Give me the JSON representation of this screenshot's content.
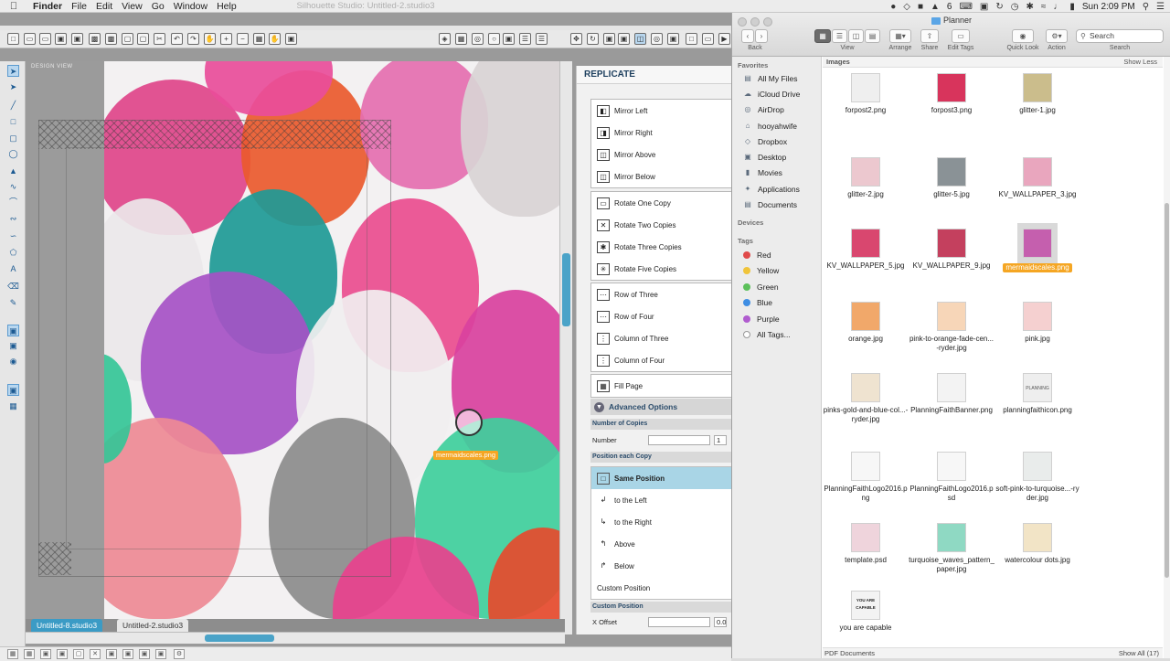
{
  "menubar": {
    "app": "Finder",
    "menus": [
      "File",
      "Edit",
      "View",
      "Go",
      "Window",
      "Help"
    ],
    "window_title": "Silhouette Studio: Untitled-2.studio3",
    "status": {
      "badge": "6",
      "clock": "Sun 2:09 PM"
    }
  },
  "studio": {
    "design_view_label": "DESIGN VIEW",
    "drag_label": "mermaidscales.png",
    "doc_tabs": [
      "Untitled-8.studio3",
      "Untitled-2.studio3"
    ],
    "colors": {
      "accent": "#3b9bc5",
      "drag": "#f5a623"
    }
  },
  "replicate": {
    "title": "REPLICATE",
    "mirror": [
      "Mirror Left",
      "Mirror Right",
      "Mirror Above",
      "Mirror Below"
    ],
    "rotate": [
      "Rotate One Copy",
      "Rotate Two Copies",
      "Rotate Three Copies",
      "Rotate Five Copies"
    ],
    "rows": [
      "Row of Three",
      "Row of Four",
      "Column of Three",
      "Column of Four"
    ],
    "fill": "Fill Page",
    "advanced": "Advanced Options",
    "number_of_copies_head": "Number of Copies",
    "number_label": "Number",
    "number_value": "1",
    "position_head": "Position each Copy",
    "positions": [
      "Same Position",
      "to the Left",
      "to the Right",
      "Above",
      "Below"
    ],
    "custom_position": "Custom Position",
    "custom_head": "Custom Position",
    "x_offset_label": "X Offset",
    "x_offset_value": "0.0"
  },
  "finder": {
    "title": "Planner",
    "toolbar_labels": [
      "Back",
      "View",
      "Arrange",
      "Share",
      "Edit Tags",
      "Quick Look",
      "Action"
    ],
    "search_placeholder": "Search",
    "search_label": "Search",
    "sidebar": {
      "favorites_head": "Favorites",
      "favorites": [
        "All My Files",
        "iCloud Drive",
        "AirDrop",
        "hooyahwife",
        "Dropbox",
        "Desktop",
        "Movies",
        "Applications",
        "Documents"
      ],
      "devices_head": "Devices",
      "tags_head": "Tags",
      "tags": [
        {
          "name": "Red",
          "color": "#e04a4a"
        },
        {
          "name": "Yellow",
          "color": "#f0c43a"
        },
        {
          "name": "Green",
          "color": "#5cc05a"
        },
        {
          "name": "Blue",
          "color": "#3f8ee3"
        },
        {
          "name": "Purple",
          "color": "#b05ccf"
        }
      ],
      "all_tags": "All Tags..."
    },
    "section_left": "Images",
    "section_right": "Show Less",
    "files": [
      {
        "name": "forpost2.png",
        "color": "#efefef"
      },
      {
        "name": "forpost3.png",
        "color": "#d8345c"
      },
      {
        "name": "glitter-1.jpg",
        "color": "#cbbd8c"
      },
      {
        "name": "glitter-2.jpg",
        "color": "#ecc8cf"
      },
      {
        "name": "glitter-5.jpg",
        "color": "#8a9296"
      },
      {
        "name": "KV_WALLPAPER_3.jpg",
        "color": "#e9a6be"
      },
      {
        "name": "KV_WALLPAPER_5.jpg",
        "color": "#d9476f"
      },
      {
        "name": "KV_WALLPAPER_9.jpg",
        "color": "#c4405e"
      },
      {
        "name": "mermaidscales.png",
        "color": "#c55fae"
      },
      {
        "name": "orange.jpg",
        "color": "#f1a86a"
      },
      {
        "name": "pink-to-orange-fade-cen...-ryder.jpg",
        "color": "#f7d6b8"
      },
      {
        "name": "pink.jpg",
        "color": "#f5d0d0"
      },
      {
        "name": "pinks-gold-and-blue-col...-ryder.jpg",
        "color": "#efe3d0"
      },
      {
        "name": "PlanningFaithBanner.png",
        "color": "#f3f3f3"
      },
      {
        "name": "planningfaithicon.png",
        "color": "#eeeeee"
      },
      {
        "name": "PlanningFaithLogo2016.png",
        "color": "#f7f7f7"
      },
      {
        "name": "PlanningFaithLogo2016.psd",
        "color": "#f7f7f7"
      },
      {
        "name": "soft-pink-to-turquoise...-ryder.jpg",
        "color": "#e9eceb"
      },
      {
        "name": "template.psd",
        "color": "#efd4dc"
      },
      {
        "name": "turquoise_waves_pattern_paper.jpg",
        "color": "#8fd9c3"
      },
      {
        "name": "watercolour dots.jpg",
        "color": "#f2e4c6"
      },
      {
        "name": "you are capable",
        "color": "#f3f3f3"
      }
    ],
    "thumb_texts": {
      "planning": "PLANNING",
      "youare": "YOU ARE CAPABLE"
    },
    "footer_left": "PDF Documents",
    "footer_right": "Show All (17)"
  }
}
